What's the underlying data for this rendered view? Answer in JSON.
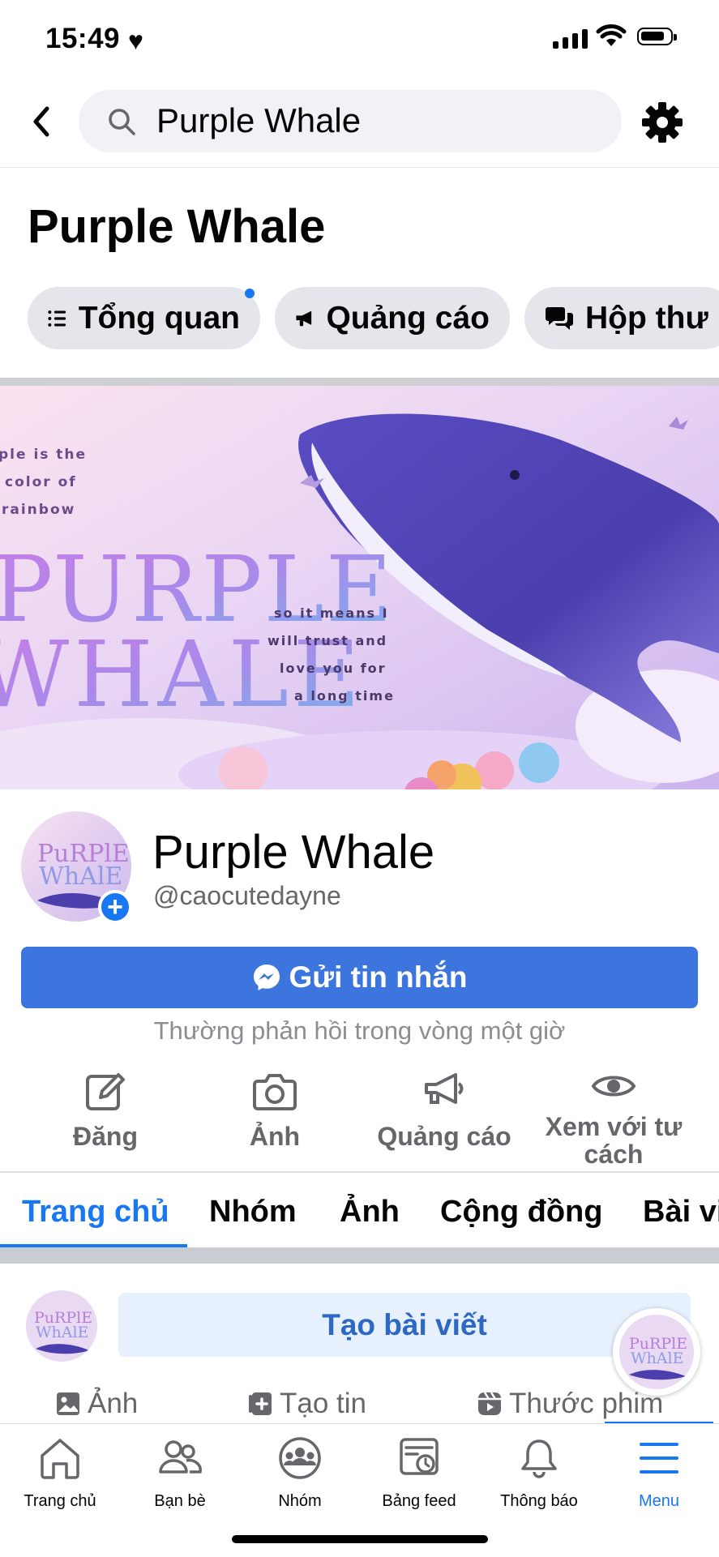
{
  "status_bar": {
    "time": "15:49",
    "heart": "♥"
  },
  "header": {
    "search_value": "Purple Whale",
    "icons": [
      "back-chevron-icon",
      "search-icon",
      "gear-icon"
    ]
  },
  "page": {
    "title": "Purple Whale"
  },
  "chips": [
    {
      "label": "Tổng quan",
      "icon": "list-icon"
    },
    {
      "label": "Quảng cáo",
      "icon": "megaphone-icon"
    },
    {
      "label": "Hộp thư",
      "icon": "chat-icon"
    }
  ],
  "cover": {
    "tagline": [
      "ple is the",
      "color of",
      "rainbow"
    ],
    "logo_lines": [
      "PURPLE",
      "WHALE"
    ],
    "caption": [
      "so it means I",
      "will trust and",
      "love you for",
      "a long time"
    ]
  },
  "profile": {
    "name": "Purple Whale",
    "handle": "@caocutedayne",
    "plus": "+"
  },
  "message_button": {
    "label": "Gửi tin nhắn"
  },
  "reply_note": "Thường phản hồi trong vòng một giờ",
  "actions": [
    {
      "label": "Đăng",
      "icon": "edit-icon"
    },
    {
      "label": "Ảnh",
      "icon": "camera-icon"
    },
    {
      "label": "Quảng cáo",
      "icon": "megaphone-icon"
    },
    {
      "label": "Xem với tư cách",
      "icon": "eye-icon"
    }
  ],
  "tabs": [
    "Trang chủ",
    "Nhóm",
    "Ảnh",
    "Cộng đồng",
    "Bài vi"
  ],
  "active_tab": "Trang chủ",
  "composer": {
    "create_label": "Tạo bài viết",
    "quick": [
      {
        "label": "Ảnh",
        "icon": "photo-icon"
      },
      {
        "label": "Tạo tin",
        "icon": "add-story-icon"
      },
      {
        "label": "Thước phim",
        "icon": "reels-icon"
      }
    ]
  },
  "bottom_nav": [
    {
      "label": "Trang chủ",
      "icon": "home-icon"
    },
    {
      "label": "Bạn bè",
      "icon": "friends-icon"
    },
    {
      "label": "Nhóm",
      "icon": "groups-icon"
    },
    {
      "label": "Bảng feed",
      "icon": "feed-icon"
    },
    {
      "label": "Thông báo",
      "icon": "bell-icon"
    },
    {
      "label": "Menu",
      "icon": "menu-icon"
    }
  ],
  "active_nav": "Menu",
  "colors": {
    "accent": "#1877f2",
    "button": "#3b75dd",
    "chip_bg": "#e4e6eb",
    "search_bg": "#f0f2f5"
  }
}
